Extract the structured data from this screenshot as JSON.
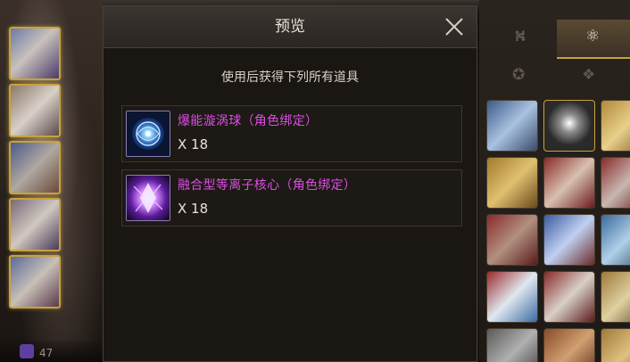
{
  "dialog": {
    "title": "预览",
    "description": "使用后获得下列所有道具",
    "close_icon": "close-x-icon"
  },
  "items": [
    {
      "name": "爆能漩涡球（角色绑定）",
      "quantity": "X 18",
      "icon": "energy-vortex-orb-icon",
      "name_color": "#d94fe0"
    },
    {
      "name": "融合型等离子核心（角色绑定）",
      "quantity": "X 18",
      "icon": "fusion-plasma-core-icon",
      "name_color": "#d94fe0"
    }
  ],
  "background": {
    "bottom_counter": "47"
  },
  "colors": {
    "accent_gold": "#c9a23a",
    "item_purple": "#d94fe0",
    "panel_dark": "#1a1612"
  }
}
